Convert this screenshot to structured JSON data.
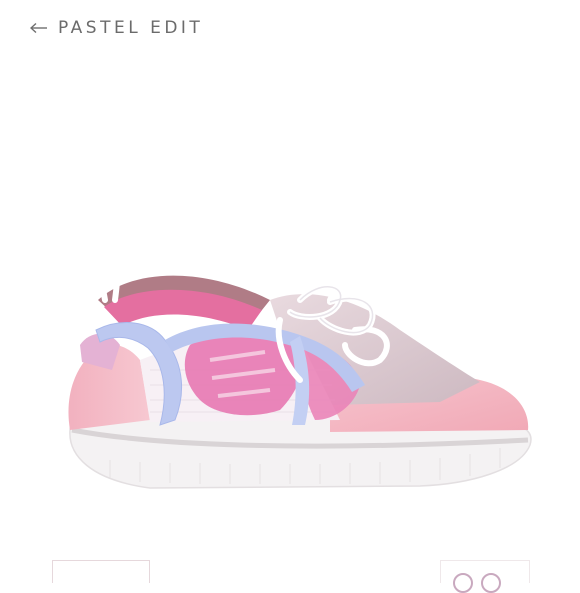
{
  "header": {
    "back_label": "PASTEL EDIT",
    "back_icon": "arrow-left-icon"
  },
  "product": {
    "image_icon": "sneaker-image",
    "colors": {
      "sole": "#f3f1f2",
      "upper_pink": "#f1b6c2",
      "accent_pink": "#e46fa6",
      "accent_blue": "#b9c6ef",
      "lace": "#ffffff",
      "knit": "#d9c9cf"
    }
  },
  "thumbnails": {
    "count_visible": 2
  }
}
